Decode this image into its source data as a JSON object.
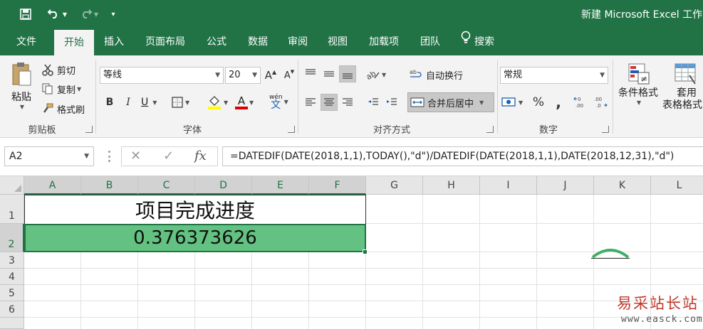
{
  "window": {
    "title": "新建 Microsoft Excel 工作"
  },
  "tabs": [
    "文件",
    "开始",
    "插入",
    "页面布局",
    "公式",
    "数据",
    "审阅",
    "视图",
    "加载项",
    "团队"
  ],
  "search_label": "搜索",
  "ribbon": {
    "clipboard": {
      "paste": "粘贴",
      "cut": "剪切",
      "copy": "复制",
      "format_painter": "格式刷",
      "label": "剪贴板"
    },
    "font": {
      "name": "等线",
      "size": "20",
      "grow": "A",
      "shrink": "A",
      "bold": "B",
      "italic": "I",
      "underline": "U",
      "wen": "wén",
      "wen_char": "文",
      "font_color_letter": "A",
      "label": "字体"
    },
    "alignment": {
      "wrap": "自动换行",
      "merge": "合并后居中",
      "label": "对齐方式"
    },
    "number": {
      "format": "常规",
      "percent": "%",
      "comma": ",",
      "label": "数字"
    },
    "styles": {
      "conditional": "条件格式",
      "table_line1": "套用",
      "table_line2": "表格格式"
    }
  },
  "formula_bar": {
    "name_box": "A2",
    "cancel": "✕",
    "enter": "✓",
    "fx": "fx",
    "formula": "=DATEDIF(DATE(2018,1,1),TODAY(),\"d\")/DATEDIF(DATE(2018,1,1),DATE(2018,12,31),\"d\")"
  },
  "sheet": {
    "columns": [
      "A",
      "B",
      "C",
      "D",
      "E",
      "F",
      "G",
      "H",
      "I",
      "J",
      "K",
      "L"
    ],
    "rows": [
      "1",
      "2",
      "3",
      "4",
      "5",
      "6"
    ],
    "cells": {
      "row1_title": "项目完成进度",
      "row2_value": "0.376373626"
    },
    "highlight_color": "#63c281"
  },
  "colors": {
    "accent": "#217346"
  },
  "watermark": {
    "text": "易采站长站",
    "url": "www.easck.com"
  }
}
